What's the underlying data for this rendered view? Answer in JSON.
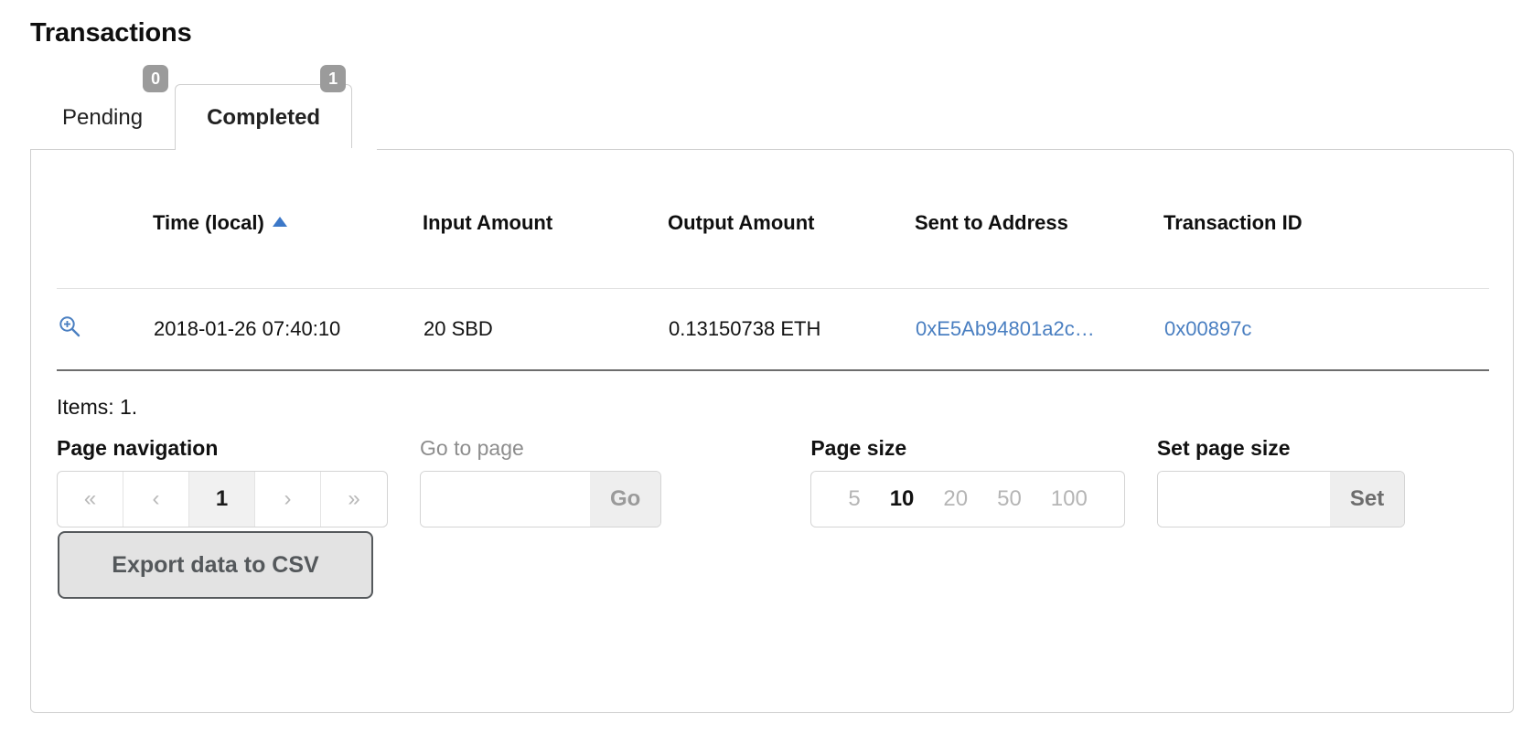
{
  "page_title": "Transactions",
  "tabs": [
    {
      "label": "Pending",
      "badge": "0",
      "active": false
    },
    {
      "label": "Completed",
      "badge": "1",
      "active": true
    }
  ],
  "table": {
    "columns": [
      {
        "key": "expand",
        "label": ""
      },
      {
        "key": "time",
        "label": "Time (local)",
        "sorted": "asc"
      },
      {
        "key": "input",
        "label": "Input Amount"
      },
      {
        "key": "output",
        "label": "Output Amount"
      },
      {
        "key": "sent",
        "label": "Sent to Address"
      },
      {
        "key": "txid",
        "label": "Transaction ID"
      }
    ],
    "rows": [
      {
        "expand_icon": "zoom-in-icon",
        "time": "2018-01-26 07:40:10",
        "input": "20 SBD",
        "output": "0.13150738 ETH",
        "sent": "0xE5Ab94801a2c…",
        "txid": "0x00897c"
      }
    ]
  },
  "footer": {
    "items_count": "Items: 1.",
    "page_navigation": {
      "label": "Page navigation",
      "first": "«",
      "prev": "‹",
      "current": "1",
      "next": "›",
      "last": "»"
    },
    "go_to_page": {
      "label": "Go to page",
      "value": "",
      "placeholder": "",
      "button": "Go"
    },
    "page_size": {
      "label": "Page size",
      "options": [
        "5",
        "10",
        "20",
        "50",
        "100"
      ],
      "selected": "10"
    },
    "set_page_size": {
      "label": "Set page size",
      "value": "",
      "placeholder": "",
      "button": "Set"
    },
    "export_button": "Export data to CSV"
  },
  "colors": {
    "link": "#4a7fc1",
    "sort_arrow": "#3c78c8",
    "badge_bg": "#9b9b9b",
    "border": "#cfcfcf"
  }
}
